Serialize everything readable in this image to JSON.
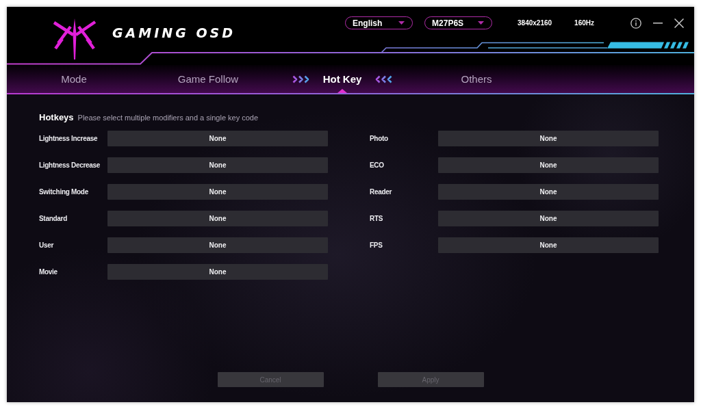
{
  "window": {
    "logo_text": "GAMING OSD",
    "language": "English",
    "monitor_model": "M27P6S",
    "resolution": "3840x2160",
    "refresh_rate": "160Hz"
  },
  "tabs": [
    {
      "label": "Mode",
      "selected": false
    },
    {
      "label": "Game Follow",
      "selected": false
    },
    {
      "label": "Hot Key",
      "selected": true
    },
    {
      "label": "Others",
      "selected": false
    }
  ],
  "hotkeys": {
    "title": "Hotkeys",
    "hint": "Please select multiple modifiers and a single key code",
    "columns": [
      {
        "items": [
          {
            "label": "Lightness Increase",
            "value": "None"
          },
          {
            "label": "Lightness Decrease",
            "value": "None"
          },
          {
            "label": "Switching Mode",
            "value": "None"
          },
          {
            "label": "Standard",
            "value": "None"
          },
          {
            "label": "User",
            "value": "None"
          },
          {
            "label": "Movie",
            "value": "None"
          }
        ]
      },
      {
        "items": [
          {
            "label": "Photo",
            "value": "None"
          },
          {
            "label": "ECO",
            "value": "None"
          },
          {
            "label": "Reader",
            "value": "None"
          },
          {
            "label": "RTS",
            "value": "None"
          },
          {
            "label": "FPS",
            "value": "None"
          }
        ]
      }
    ]
  },
  "buttons": [
    {
      "label": "Cancel",
      "disabled": true
    },
    {
      "label": "Apply",
      "disabled": true
    }
  ]
}
